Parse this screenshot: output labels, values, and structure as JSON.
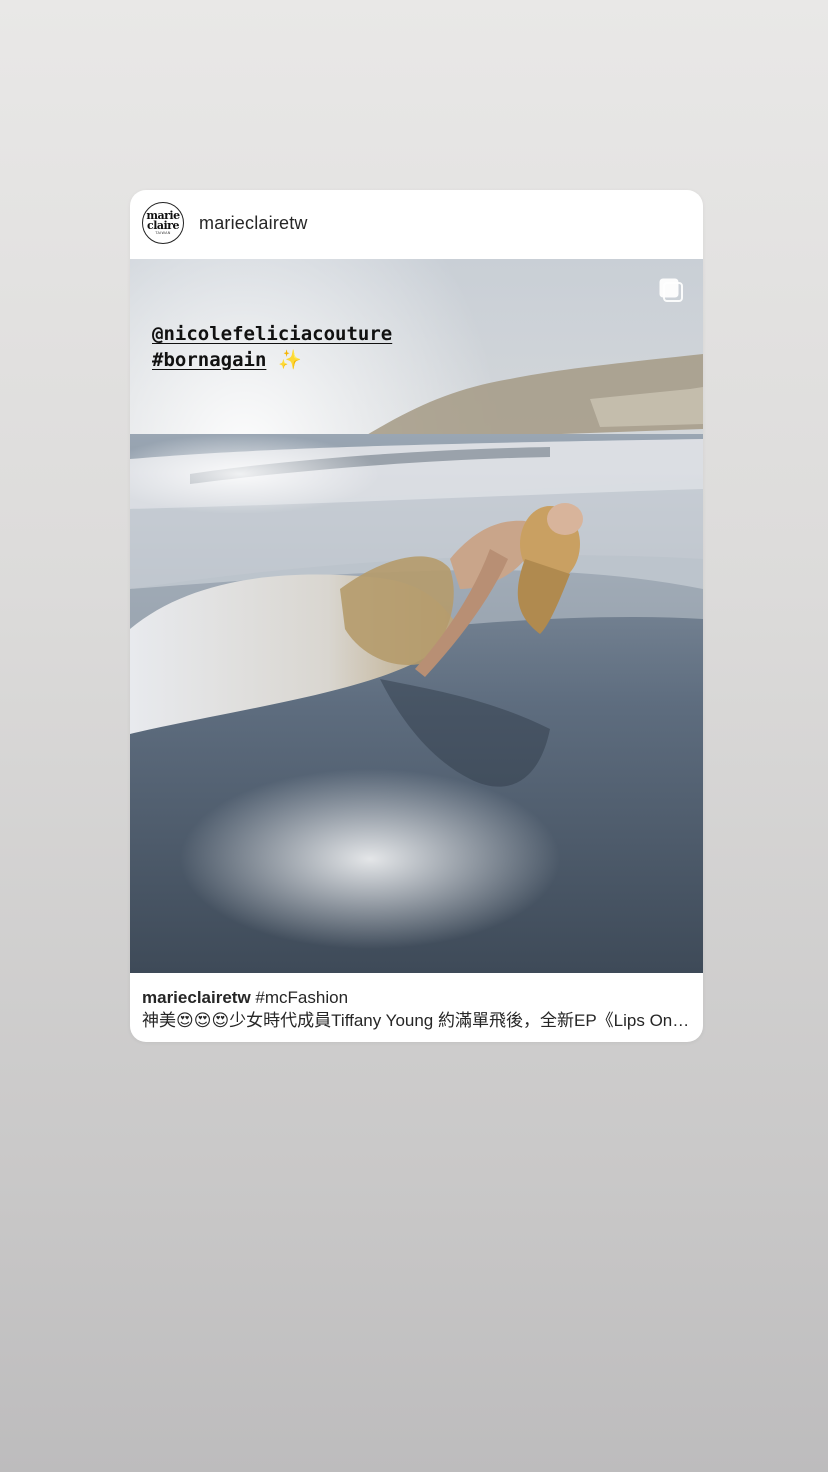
{
  "post": {
    "username": "marieclairetw",
    "avatar": {
      "line1": "marie",
      "line2": "claire",
      "line3": "TAIWAN"
    },
    "story_overlay": {
      "mention": "@nicolefeliciacouture",
      "hashtag": "#bornagain",
      "emoji": "✨"
    },
    "caption": {
      "username": "marieclairetw",
      "hashtag": "#mcFashion",
      "text": "神美😍😍😍少女時代成員Tiffany Young 約滿單飛後，全新EP《Lips On Lips》"
    }
  },
  "icons": {
    "multi_post": "carousel-icon"
  },
  "colors": {
    "background": "#dcdbda",
    "card": "#ffffff",
    "text": "#262626"
  }
}
